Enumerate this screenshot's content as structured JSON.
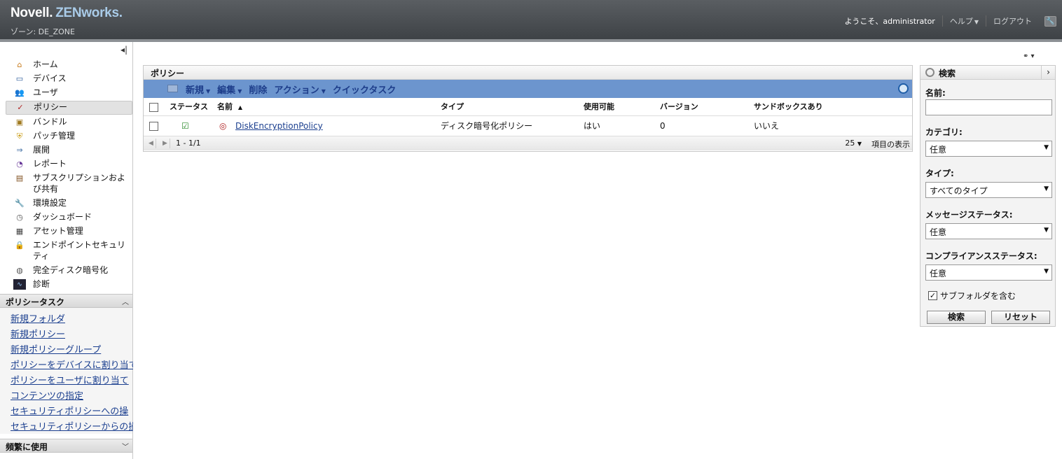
{
  "header": {
    "brand_part1": "Novell.",
    "brand_part2": "ZENworks.",
    "zone": "ゾーン: DE_ZONE",
    "welcome": "ようこそ、administrator",
    "help": "ヘルプ",
    "logout": "ログアウト"
  },
  "nav": {
    "items": [
      {
        "label": "ホーム",
        "icon": "home-icon"
      },
      {
        "label": "デバイス",
        "icon": "monitor-icon"
      },
      {
        "label": "ユーザ",
        "icon": "users-icon"
      },
      {
        "label": "ポリシー",
        "icon": "policy-icon"
      },
      {
        "label": "バンドル",
        "icon": "bundle-icon"
      },
      {
        "label": "パッチ管理",
        "icon": "shield-icon"
      },
      {
        "label": "展開",
        "icon": "deploy-icon"
      },
      {
        "label": "レポート",
        "icon": "report-icon"
      },
      {
        "label": "サブスクリプションおよび共有",
        "icon": "subscription-icon"
      },
      {
        "label": "環境設定",
        "icon": "wrench-icon"
      },
      {
        "label": "ダッシュボード",
        "icon": "gauge-icon"
      },
      {
        "label": "アセット管理",
        "icon": "asset-icon"
      },
      {
        "label": "エンドポイントセキュリティ",
        "icon": "lock-icon"
      },
      {
        "label": "完全ディスク暗号化",
        "icon": "disk-encryption-icon"
      },
      {
        "label": "診断",
        "icon": "diagnostics-icon"
      }
    ]
  },
  "tasks": {
    "title": "ポリシータスク",
    "links": [
      "新規フォルダ",
      "新規ポリシー",
      "新規ポリシーグループ",
      "ポリシーをデバイスに割り当て",
      "ポリシーをユーザに割り当て",
      "コンテンツの指定",
      "セキュリティポリシーへの操",
      "セキュリティポリシーからの操"
    ]
  },
  "frequent": {
    "title": "頻繁に使用"
  },
  "panel": {
    "title": "ポリシー",
    "toolbar": {
      "new": "新規",
      "edit": "編集",
      "delete": "削除",
      "action": "アクション",
      "quick_task": "クイックタスク"
    },
    "columns": {
      "status": "ステータス",
      "name": "名前",
      "type": "タイプ",
      "enabled": "使用可能",
      "version": "バージョン",
      "sandbox": "サンドボックスあり"
    },
    "rows": [
      {
        "name": "DiskEncryptionPolicy",
        "type": "ディスク暗号化ポリシー",
        "enabled": "はい",
        "version": "0",
        "sandbox": "いいえ"
      }
    ],
    "footer": {
      "range": "1 - 1/1",
      "page_size": "25",
      "items_label": "項目の表示"
    }
  },
  "search": {
    "title": "検索",
    "name_label": "名前:",
    "name_value": "",
    "category_label": "カテゴリ:",
    "category_value": "任意",
    "type_label": "タイプ:",
    "type_value": "すべてのタイプ",
    "message_label": "メッセージステータス:",
    "message_value": "任意",
    "compliance_label": "コンプライアンスステータス:",
    "compliance_value": "任意",
    "subfolders_label": "サブフォルダを含む",
    "search_button": "検索",
    "reset_button": "リセット"
  }
}
